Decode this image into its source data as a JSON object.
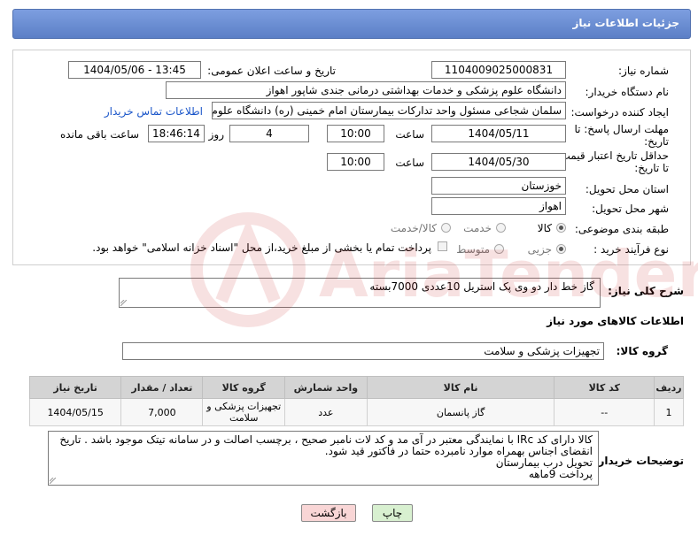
{
  "header": {
    "title": "جزئیات اطلاعات نیاز"
  },
  "form": {
    "need_number_label": "شماره نیاز:",
    "need_number": "1104009025000831",
    "announce_label": "تاریخ و ساعت اعلان عمومی:",
    "announce_value": "1404/05/06 - 13:45",
    "buyer_org_label": "نام دستگاه خریدار:",
    "buyer_org": "دانشگاه علوم پزشکی و خدمات بهداشتی درمانی جندی شاپور اهواز",
    "requester_label": "ایجاد کننده درخواست:",
    "requester": "سلمان شجاعی مسئول واحد تدارکات بیمارستان امام خمینی (ره) دانشگاه علوم",
    "contact_link": "اطلاعات تماس خریدار",
    "deadline_label_1": "مهلت ارسال پاسخ: تا",
    "deadline_label_2": "تاریخ:",
    "deadline_date": "1404/05/11",
    "time_label": "ساعت",
    "deadline_time": "10:00",
    "days_value": "4",
    "days_label": "روز و",
    "remaining_time": "18:46:14",
    "remaining_label": "ساعت باقی مانده",
    "validity_label_1": "حداقل تاریخ اعتبار قیمت:",
    "validity_label_2": "تا تاریخ:",
    "validity_date": "1404/05/30",
    "validity_time": "10:00",
    "province_label": "استان محل تحویل:",
    "province": "خوزستان",
    "city_label": "شهر محل تحویل:",
    "city": "اهواز",
    "category_label": "طبقه بندی موضوعی:",
    "category_options": [
      "کالا",
      "خدمت",
      "کالا/خدمت"
    ],
    "process_label": "نوع فرآیند خرید :",
    "process_options": [
      "جزیی",
      "متوسط"
    ],
    "payment_note": "پرداخت تمام یا بخشی از مبلغ خرید،از محل \"اسناد خزانه اسلامی\" خواهد بود."
  },
  "summary": {
    "label": "شرح کلی نیاز:",
    "value": "گاز خط دار دو وی پک استریل 10عددی        7000بسته"
  },
  "goods": {
    "section_title": "اطلاعات کالاهای مورد نیاز",
    "group_label": "گروه کالا:",
    "group_value": "تجهیزات پزشکی و سلامت"
  },
  "table": {
    "headers": [
      "ردیف",
      "کد کالا",
      "نام کالا",
      "واحد شمارش",
      "گروه کالا",
      "تعداد / مقدار",
      "تاریخ نیاز"
    ],
    "rows": [
      [
        "1",
        "--",
        "گاز پانسمان",
        "عدد",
        "تجهیزات پزشکی و سلامت",
        "7,000",
        "1404/05/15"
      ]
    ]
  },
  "buyer_notes": {
    "label": "توضیحات خریدار:",
    "lines": [
      "کالا دارای کد IRc با نمایندگی معتبر در آی مد و کد لات نامبر صحیح ، برچسب اصالت و در سامانه تیتک موجود باشد . تاریخ",
      "انقضای اجناس بهمراه موارد نامبرده حتما در فاکتور قید شود.",
      "تحویل درب بیمارستان",
      "پرداخت 9ماهه"
    ]
  },
  "buttons": {
    "print": "چاپ",
    "back": "بازگشت"
  },
  "watermark": {
    "text": "AriaTender.net"
  },
  "colors": {
    "header": "#6a8cd4",
    "link": "#1b56c9",
    "back_button": "#f9d6d6",
    "print_button": "#d8f0d0"
  }
}
